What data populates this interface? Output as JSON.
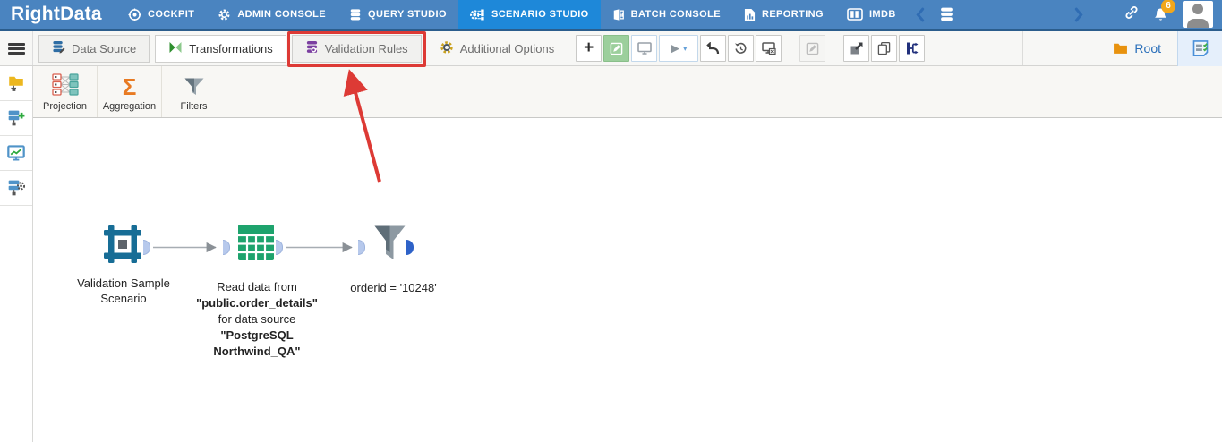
{
  "colors": {
    "topbar_bg": "#4a84c0",
    "topbar_active_bg": "#1e88d9",
    "topbar_border": "#2b5d8c",
    "badge_bg": "#f2a71b",
    "annotation_red": "#dd3a35",
    "edit_green": "#9ccf9c",
    "aggregation_orange": "#e87a22",
    "table_green": "#1ea36d",
    "scenario_teal": "#176d96",
    "funnel_gray": "#66757f",
    "root_blue": "#2a6fba",
    "port_blue": "#b7c9ec",
    "port_dark_blue": "#2e62c8"
  },
  "topnav": {
    "logo": "RightData",
    "items": [
      {
        "label": "COCKPIT"
      },
      {
        "label": "ADMIN CONSOLE"
      },
      {
        "label": "QUERY STUDIO"
      },
      {
        "label": "SCENARIO STUDIO"
      },
      {
        "label": "BATCH CONSOLE"
      },
      {
        "label": "REPORTING"
      },
      {
        "label": "IMDB"
      }
    ],
    "notification_count": "6"
  },
  "tabbar": {
    "tabs": [
      {
        "label": "Data Source"
      },
      {
        "label": "Transformations"
      },
      {
        "label": "Validation Rules"
      },
      {
        "label": "Additional Options"
      }
    ],
    "root_label": "Root"
  },
  "glyphs": {
    "plus": "+",
    "play": "▶",
    "caret": "▾"
  },
  "palette": {
    "sigma": "Σ",
    "items": [
      {
        "label": "Projection"
      },
      {
        "label": "Aggregation"
      },
      {
        "label": "Filters"
      }
    ]
  },
  "canvas": {
    "node1": {
      "lines": [
        "Validation Sample",
        "Scenario"
      ]
    },
    "node2": {
      "lines": [
        "Read data from",
        "\"public.order_details\"",
        "for data source",
        "\"PostgreSQL",
        "Northwind_QA\""
      ]
    },
    "node3": {
      "label": "orderid = '10248'"
    }
  }
}
